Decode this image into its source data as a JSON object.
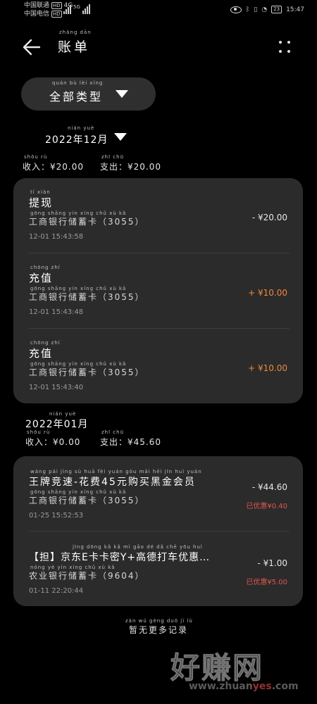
{
  "status_bar": {
    "carrier1": "中国联通",
    "carrier2": "中国电信",
    "hd_tag": "HD",
    "net_4g": "4G",
    "net_5g": "5G",
    "battery": "23",
    "time": "15:47"
  },
  "header": {
    "title": "账单",
    "title_pinyin": "zhàng dān"
  },
  "filter": {
    "label": "全部类型",
    "label_pinyin": "quán bù lèi xíng"
  },
  "months": [
    {
      "label": "2022年12月",
      "pinyin": "nián  yuè",
      "income": "收入：¥20.00",
      "income_pinyin": "shōu rù",
      "expense": "支出：¥20.00",
      "expense_pinyin": "zhī chū",
      "records": [
        {
          "title": "提现",
          "title_pinyin": "tí xiàn",
          "account": "工商银行储蓄卡（3055）",
          "account_pinyin": "gōng shāng yín xíng chǔ xù kǎ",
          "time": "12-01 15:43:58",
          "amount": "- ¥20.00",
          "amount_color": "#e6e6e6"
        },
        {
          "title": "充值",
          "title_pinyin": "chōng zhí",
          "account": "工商银行储蓄卡（3055）",
          "account_pinyin": "gōng shāng yín xíng chǔ xù kǎ",
          "time": "12-01 15:43:48",
          "amount": "+ ¥10.00",
          "amount_color": "#f0873a"
        },
        {
          "title": "充值",
          "title_pinyin": "chōng zhí",
          "account": "工商银行储蓄卡（3055）",
          "account_pinyin": "gōng shāng yín xíng chǔ xù kǎ",
          "time": "12-01 15:43:40",
          "amount": "+ ¥10.00",
          "amount_color": "#f0873a"
        }
      ]
    },
    {
      "label": "2022年01月",
      "pinyin": "nián  yuè",
      "income": "收入：¥0.00",
      "income_pinyin": "shōu rù",
      "expense": "支出：¥45.60",
      "expense_pinyin": "zhī chū",
      "records": [
        {
          "title": "王牌竞速-花费45元购买黑金会员",
          "title_pinyin": "wáng pái jìng sù  huā fèi  yuán gòu mǎi hēi jīn huì yuán",
          "account": "工商银行储蓄卡（3055）",
          "account_pinyin": "gōng shāng yín xíng chǔ xù kǎ",
          "time": "01-25 15:52:53",
          "amount": "- ¥44.60",
          "amount_color": "#e6e6e6",
          "discount": "已优惠¥0.40"
        },
        {
          "title": "【担】京东E卡卡密Y+高德打车优惠…",
          "title_pinyin": "jīng dōng  kǎ kǎ mì  gāo dé dǎ chē yōu huì",
          "account": "农业银行储蓄卡（9604）",
          "account_pinyin": "nóng yè yín xíng chǔ xù kǎ",
          "time": "01-11 22:20:44",
          "amount": "- ¥1.00",
          "amount_color": "#e6e6e6",
          "discount": "已优惠¥5.00"
        }
      ]
    }
  ],
  "footer": {
    "text": "暂无更多记录",
    "pinyin": "zàn wú gèng duō jì lù"
  },
  "watermark": {
    "big": "好赚网",
    "url_a": "www.zhuan",
    "url_b": "yes",
    "url_c": ".com"
  },
  "icons": {
    "back": "arrow-left-icon",
    "more": "more-vertical-icon",
    "dropdown": "triangle-down-icon"
  }
}
